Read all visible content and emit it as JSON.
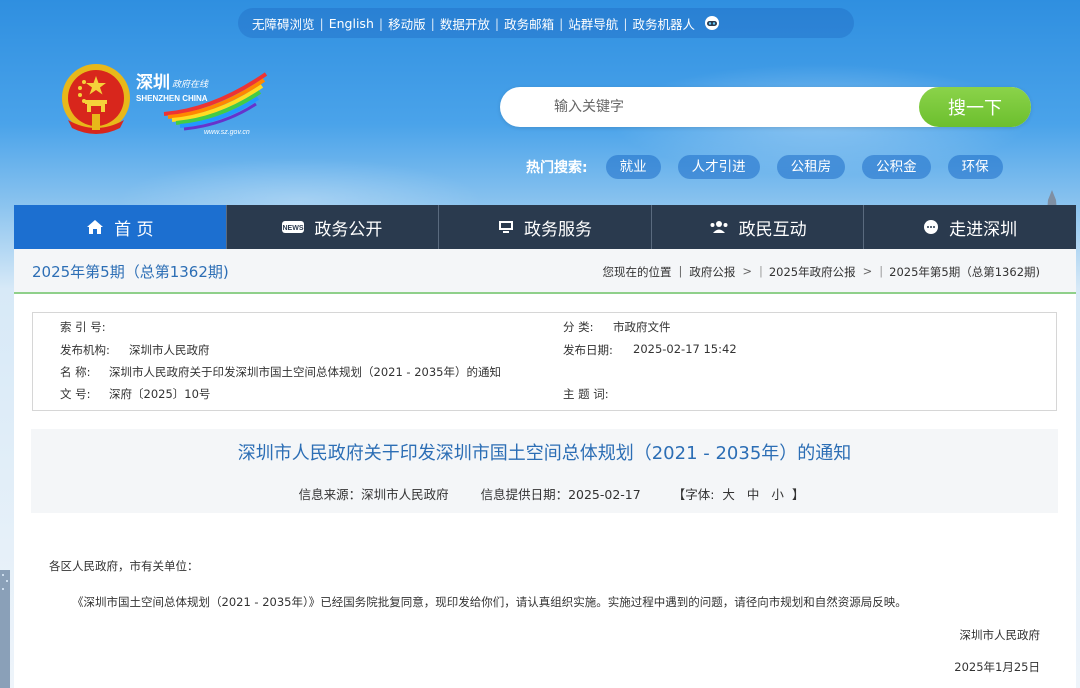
{
  "topbar": {
    "links": [
      "无障碍浏览",
      "English",
      "移动版",
      "数据开放",
      "政务邮箱",
      "站群导航",
      "政务机器人"
    ]
  },
  "logo": {
    "title": "深圳",
    "subtitle": "政府在线",
    "latin": "SHENZHEN CHINA",
    "url": "www.sz.gov.cn"
  },
  "search": {
    "placeholder": "输入关键字",
    "button": "搜一下"
  },
  "hot": {
    "label": "热门搜索:",
    "tags": [
      "就业",
      "人才引进",
      "公租房",
      "公积金",
      "环保"
    ]
  },
  "nav": {
    "items": [
      {
        "label": "首 页",
        "icon": "home-icon"
      },
      {
        "label": "政务公开",
        "icon": "news-icon"
      },
      {
        "label": "政务服务",
        "icon": "monitor-icon"
      },
      {
        "label": "政民互动",
        "icon": "people-icon"
      },
      {
        "label": "走进深圳",
        "icon": "chat-icon"
      }
    ],
    "active_index": 0
  },
  "issue": {
    "title": "2025年第5期（总第1362期)",
    "breadcrumb": [
      "您现在的位置",
      "政府公报",
      "2025年政府公报",
      "2025年第5期（总第1362期)"
    ]
  },
  "meta": {
    "index_no_label": "索 引 号:",
    "index_no": "",
    "category_label": "分  类:",
    "category": "市政府文件",
    "publisher_label": "发布机构:",
    "publisher": "深圳市人民政府",
    "date_label": "发布日期:",
    "date": "2025-02-17 15:42",
    "name_label": "名  称:",
    "name": "深圳市人民政府关于印发深圳市国土空间总体规划（2021 - 2035年）的通知",
    "doc_no_label": "文  号:",
    "doc_no": "深府〔2025〕10号",
    "subject_label": "主 题 词:",
    "subject": ""
  },
  "doc": {
    "title": "深圳市人民政府关于印发深圳市国土空间总体规划（2021 - 2035年）的通知",
    "source": "信息来源：深圳市人民政府",
    "provide_date": "信息提供日期：2025-02-17",
    "font_label": "【字体:",
    "font_sizes": [
      "大",
      "中",
      "小"
    ],
    "font_close": "】",
    "salutation": "各区人民政府，市有关单位：",
    "paragraph": "《深圳市国土空间总体规划（2021 - 2035年）》已经国务院批复同意，现印发给你们，请认真组织实施。实施过程中遇到的问题，请径向市规划和自然资源局反映。",
    "signature": "深圳市人民政府",
    "sign_date": "2025年1月25日"
  },
  "colors": {
    "nav_bg": "#2a3a4e",
    "nav_active": "#1c6fd0",
    "search_button": "#7cc93c",
    "title_blue": "#2c6eb5",
    "divider_green": "#8fd08a"
  }
}
